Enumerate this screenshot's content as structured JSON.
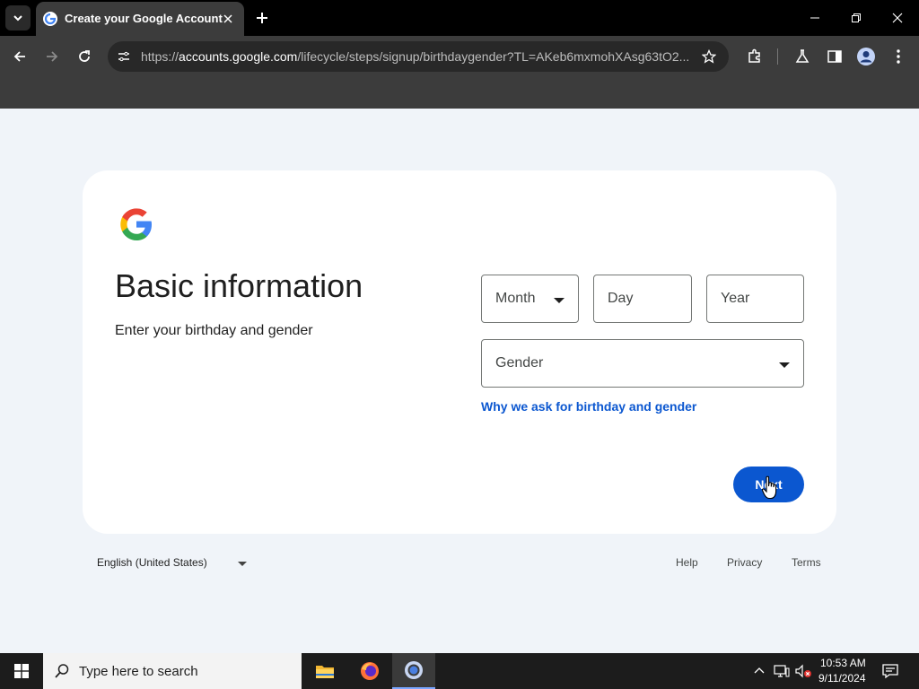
{
  "browser": {
    "tab_title": "Create your Google Account",
    "url_prefix": "https://",
    "url_domain": "accounts.google.com",
    "url_path": "/lifecycle/steps/signup/birthdaygender?TL=AKeb6mxmohXAsg63tO2..."
  },
  "form": {
    "heading": "Basic information",
    "subheading": "Enter your birthday and gender",
    "month_label": "Month",
    "day_label": "Day",
    "year_label": "Year",
    "gender_label": "Gender",
    "why_link": "Why we ask for birthday and gender",
    "next_label": "Next"
  },
  "footer": {
    "language": "English (United States)",
    "help": "Help",
    "privacy": "Privacy",
    "terms": "Terms"
  },
  "taskbar": {
    "search_placeholder": "Type here to search",
    "time": "10:53 AM",
    "date": "9/11/2024"
  },
  "colors": {
    "accent": "#0b57d0",
    "page_bg": "#f0f4f9"
  }
}
